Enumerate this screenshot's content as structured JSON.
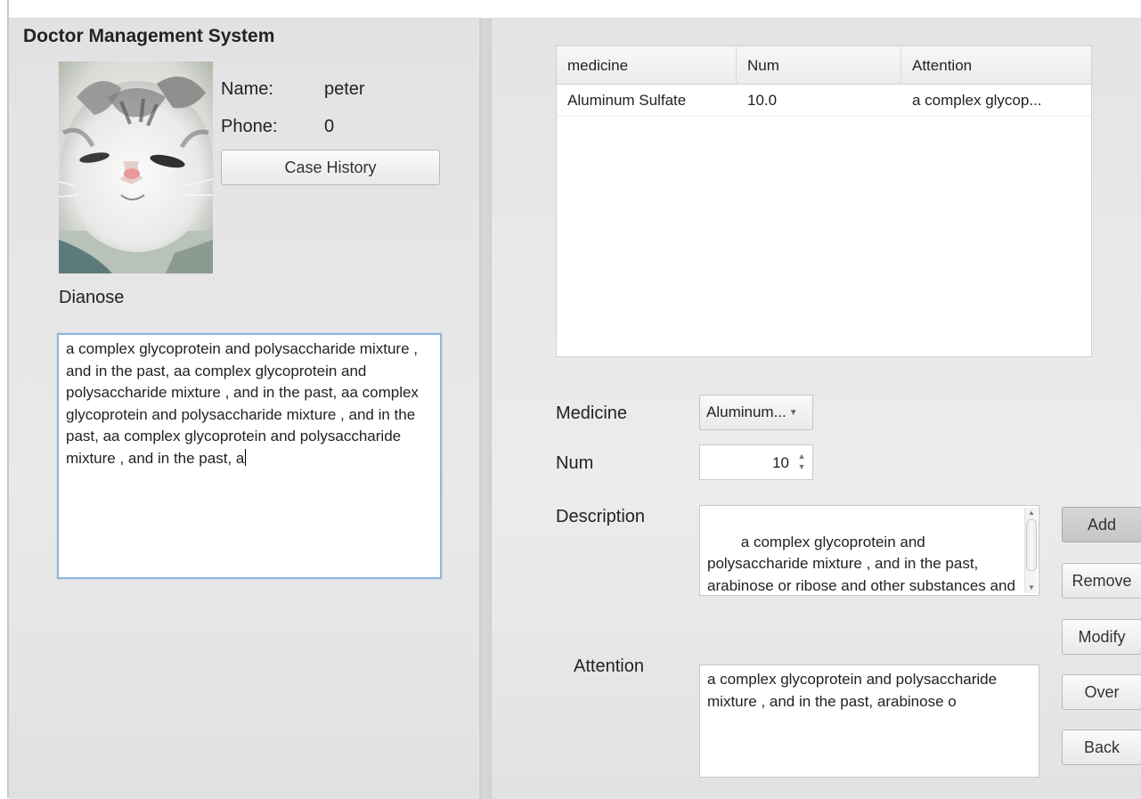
{
  "app": {
    "title": "Doctor Management System"
  },
  "profile": {
    "name_label": "Name:",
    "name_value": "peter",
    "phone_label": "Phone:",
    "phone_value": "0",
    "case_history_button": "Case History",
    "photo_icon": "cat-photo"
  },
  "diagnose": {
    "label": "Dianose",
    "text": "a complex glycoprotein and polysaccharide mixture , and in the past, aa complex glycoprotein and polysaccharide mixture , and in the past, aa complex glycoprotein and polysaccharide mixture , and in the past, aa complex glycoprotein and polysaccharide mixture , and in the past, a"
  },
  "prescription_table": {
    "columns": [
      "medicine",
      "Num",
      "Attention"
    ],
    "rows": [
      [
        "Aluminum Sulfate",
        "10.0",
        "a complex glycop..."
      ]
    ]
  },
  "form": {
    "medicine_label": "Medicine",
    "medicine_selected": "Aluminum...",
    "num_label": "Num",
    "num_value": "10",
    "description_label": "Description",
    "description_text": "a complex glycoprotein and polysaccharide mixture , and in the past, arabinose or ribose and other substances and composed of to the",
    "attention_label": "Attention",
    "attention_text": "a complex glycoprotein and polysaccharide mixture , and in the past, arabinose o"
  },
  "actions": {
    "add": "Add",
    "remove": "Remove",
    "modify": "Modify",
    "over": "Over",
    "back": "Back"
  }
}
